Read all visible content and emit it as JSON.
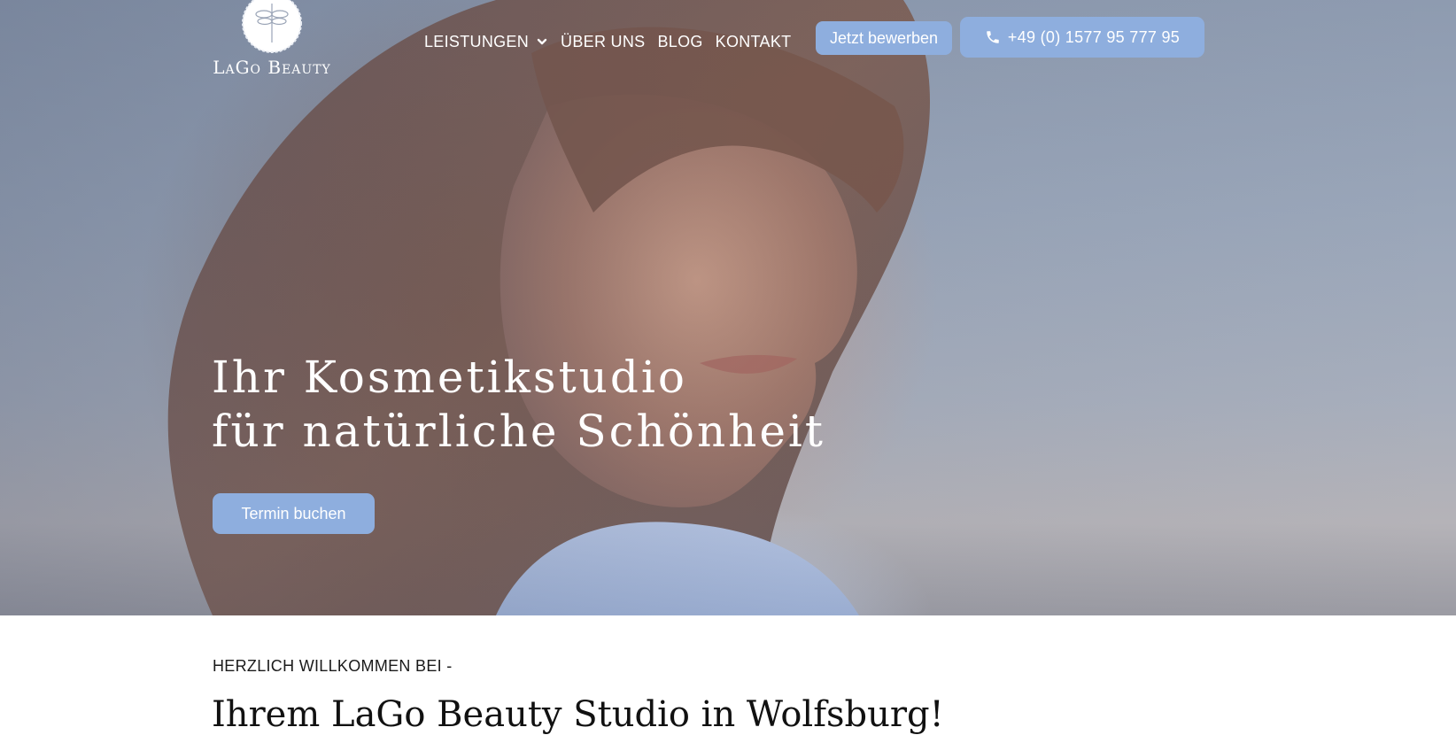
{
  "header": {
    "logo_text": "LaGo Beauty",
    "nav": [
      {
        "label": "LEISTUNGEN",
        "has_dropdown": true
      },
      {
        "label": "ÜBER UNS"
      },
      {
        "label": "BLOG"
      },
      {
        "label": "KONTAKT"
      }
    ],
    "apply_button": "Jetzt bewerben",
    "phone_button": "+49 (0) 1577 95 777 95",
    "icons": {
      "dropdown": "chevron-down-icon",
      "phone": "phone-icon"
    }
  },
  "hero": {
    "title_line1": "Ihr Kosmetikstudio",
    "title_line2": "für natürliche Schönheit",
    "cta": "Termin buchen"
  },
  "intro": {
    "label": "HERZLICH WILLKOMMEN BEI -",
    "title": "Ihrem LaGo Beauty Studio in Wolfsburg!"
  },
  "colors": {
    "accent": "#8eaede",
    "text_light": "#ffffff",
    "text_dark": "#1a1a1a"
  }
}
